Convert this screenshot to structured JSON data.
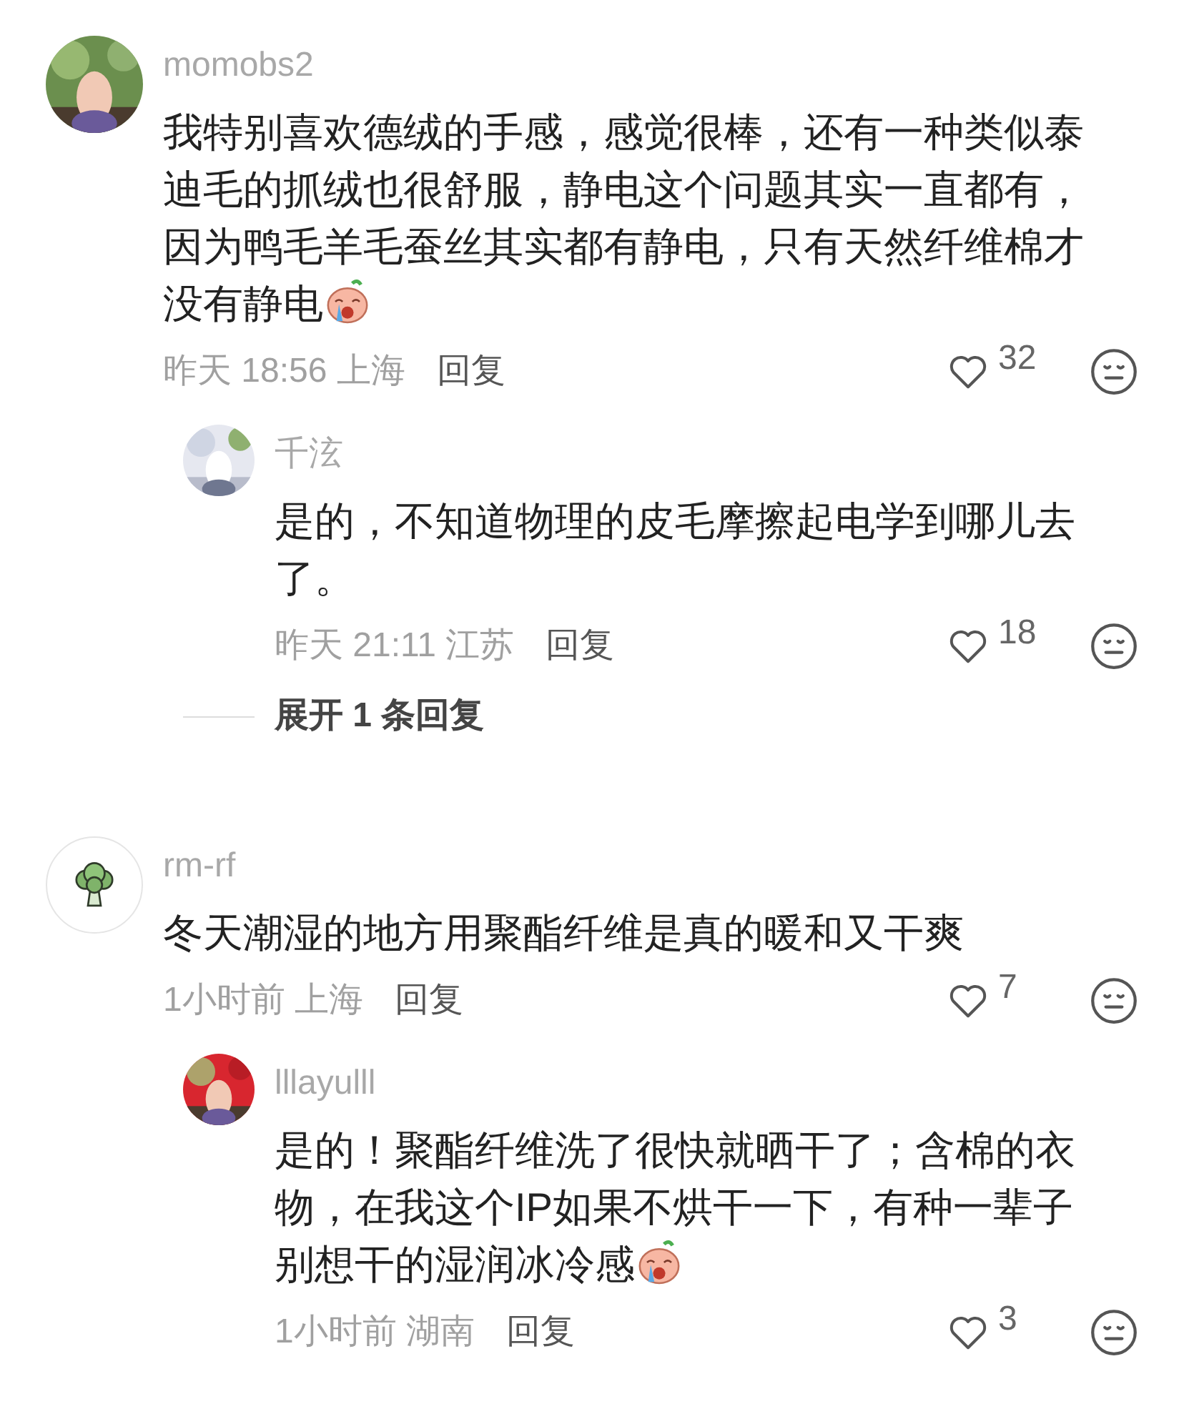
{
  "comments": [
    {
      "avatar": {
        "kind": "picture"
      },
      "username": "momobs2",
      "text": "我特别喜欢德绒的手感，感觉很棒，还有一种类似泰迪毛的抓绒也很舒服，静电这个问题其实一直都有，因为鸭毛羊毛蚕丝其实都有静电，只有天然纤维棉才没有静电",
      "sticker": true,
      "time": "昨天 18:56 上海",
      "reply_label": "回复",
      "likes": "32",
      "replies": [
        {
          "avatar": {
            "kind": "picture"
          },
          "username": "千泫",
          "text": "是的，不知道物理的皮毛摩擦起电学到哪儿去了。",
          "sticker": false,
          "time": "昨天 21:11 江苏",
          "reply_label": "回复",
          "likes": "18"
        }
      ],
      "expand_label": "展开 1 条回复"
    },
    {
      "avatar": {
        "kind": "broccoli"
      },
      "username": "rm-rf",
      "text": "冬天潮湿的地方用聚酯纤维是真的暖和又干爽",
      "sticker": false,
      "time": "1小时前 上海",
      "reply_label": "回复",
      "likes": "7",
      "replies": [
        {
          "avatar": {
            "kind": "picture"
          },
          "username": "lllayulll",
          "text": "是的！聚酯纤维洗了很快就晒干了；含棉的衣物，在我这个IP如果不烘干一下，有种一辈子别想干的湿润冰冷感",
          "sticker": true,
          "time": "1小时前 湖南",
          "reply_label": "回复",
          "likes": "3"
        }
      ]
    }
  ]
}
